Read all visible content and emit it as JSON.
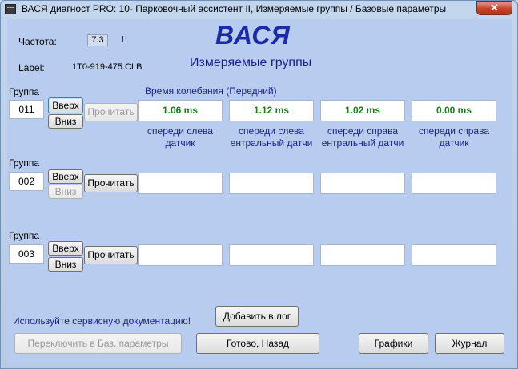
{
  "window": {
    "title": "ВАСЯ диагност PRO: 10- Парковочный ассистент II,  Измеряемые группы / Базовые параметры",
    "close_label": "✕"
  },
  "header": {
    "freq_label": "Частота:",
    "freq_value": "7.3",
    "freq_unit": "l",
    "label_label": "Label:",
    "label_value": "1T0-919-475.CLB",
    "brand": "ВАСЯ",
    "subtitle": "Измеряемые группы"
  },
  "groups": [
    {
      "group_label": "Группа",
      "number": "011",
      "up_label": "Вверх",
      "down_label": "Вниз",
      "read_label": "Прочитать",
      "header_text": "Время колебания (Передний)",
      "values": [
        "1.06 ms",
        "1.12 ms",
        "1.02 ms",
        "0.00 ms"
      ],
      "captions": [
        [
          "спереди слева",
          "датчик"
        ],
        [
          "спереди слева",
          "ентральный датчи"
        ],
        [
          "спереди справа",
          "ентральный датчи"
        ],
        [
          "спереди справа",
          "датчик"
        ]
      ]
    },
    {
      "group_label": "Группа",
      "number": "002",
      "up_label": "Вверх",
      "down_label": "Вниз",
      "read_label": "Прочитать",
      "values": [
        "",
        "",
        "",
        ""
      ]
    },
    {
      "group_label": "Группа",
      "number": "003",
      "up_label": "Вверх",
      "down_label": "Вниз",
      "read_label": "Прочитать",
      "values": [
        "",
        "",
        "",
        ""
      ]
    }
  ],
  "footer": {
    "service_note": "Используйте сервисную документацию!",
    "add_log_label": "Добавить в лог",
    "switch_basic_label": "Переключить в Баз. параметры",
    "done_back_label": "Готово, Назад",
    "graphs_label": "Графики",
    "journal_label": "Журнал"
  }
}
